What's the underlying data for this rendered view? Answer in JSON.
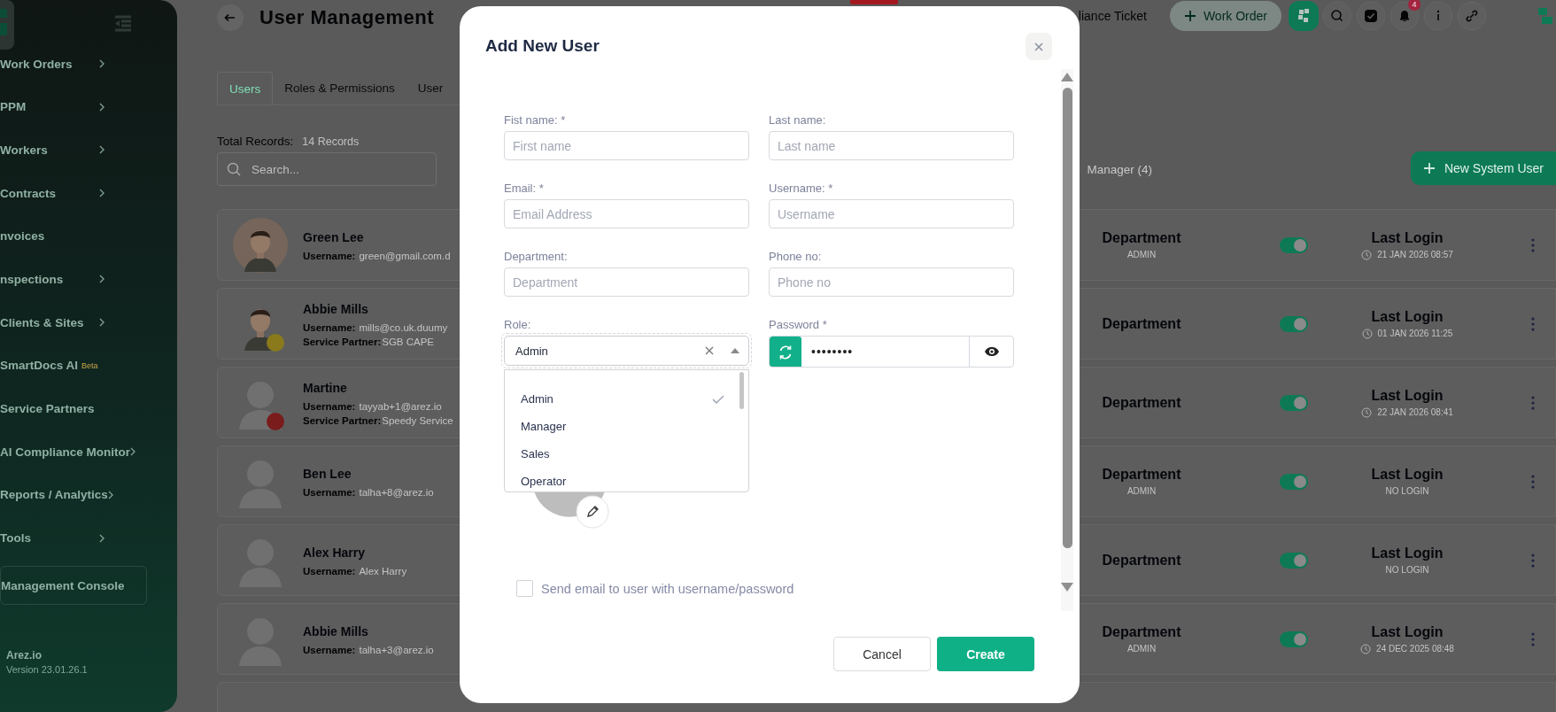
{
  "sidebar": {
    "items": [
      {
        "label": "Work Orders",
        "has_arrow": true,
        "selected": false
      },
      {
        "label": "PPM",
        "has_arrow": true,
        "selected": false
      },
      {
        "label": "Workers",
        "has_arrow": true,
        "selected": false
      },
      {
        "label": "Contracts",
        "has_arrow": true,
        "selected": false
      },
      {
        "label": "nvoices",
        "has_arrow": false,
        "selected": false
      },
      {
        "label": "nspections",
        "has_arrow": true,
        "selected": false
      },
      {
        "label": "Clients & Sites",
        "has_arrow": true,
        "selected": false
      },
      {
        "label": "SmartDocs AI",
        "tag": "Beta",
        "has_arrow": false,
        "selected": false
      },
      {
        "label": "Service Partners",
        "has_arrow": false,
        "selected": false
      },
      {
        "label": "AI Compliance Monitor",
        "has_arrow": true,
        "selected": false
      },
      {
        "label": "Reports / Analytics",
        "has_arrow": true,
        "selected": false
      },
      {
        "label": "Tools",
        "has_arrow": true,
        "selected": false
      },
      {
        "label": "Management Console",
        "has_arrow": false,
        "selected": true
      }
    ],
    "brand": "Arez.io",
    "version": "Version 23.01.26.1"
  },
  "header": {
    "title": "User Management",
    "ticket_label": "liance Ticket",
    "work_order_label": "Work Order",
    "notification_count": "4"
  },
  "tabs": [
    {
      "label": "Users",
      "selected": true
    },
    {
      "label": "Roles & Permissions",
      "selected": false
    },
    {
      "label": "User",
      "selected": false
    }
  ],
  "total_records": {
    "label": "Total Records:",
    "value": "14 Records"
  },
  "search": {
    "placeholder": "Search..."
  },
  "filter_label": "Manager (4)",
  "new_user_button": "New System User",
  "users": [
    {
      "name": "Green Lee",
      "kind": "illustrated",
      "username_label": "Username:",
      "username": "green@gmail.com.d",
      "department": "Department",
      "department_role": "ADMIN",
      "active": true,
      "last_login_label": "Last Login",
      "last_login": "21 JAN 2026 08:57"
    },
    {
      "name": "Abbie Mills",
      "kind": "illustrated",
      "color": "#8a7a1c",
      "username_label": "Username:",
      "username": "mills@co.uk.duumy",
      "partner_label": "Service Partner:",
      "partner": "SGB CAPE",
      "department": "Department",
      "active": true,
      "last_login_label": "Last Login",
      "last_login": "01 JAN 2026 11:25"
    },
    {
      "name": "Martine",
      "kind": "placeholder",
      "color": "#7a1c1c",
      "username_label": "Username:",
      "username": "tayyab+1@arez.io",
      "partner_label": "Service Partner:",
      "partner": "Speedy Service",
      "department": "Department",
      "active": true,
      "last_login_label": "Last Login",
      "last_login": "22 JAN 2026 08:41"
    },
    {
      "name": "Ben Lee",
      "kind": "placeholder",
      "username_label": "Username:",
      "username": "talha+8@arez.io",
      "department": "Department",
      "department_role": "ADMIN",
      "active": true,
      "last_login_label": "Last Login",
      "last_login": "NO LOGIN"
    },
    {
      "name": "Alex Harry",
      "kind": "placeholder",
      "username_label": "Username:",
      "username": "Alex Harry",
      "department": "Department",
      "active": true,
      "last_login_label": "Last Login",
      "last_login": "NO LOGIN"
    },
    {
      "name": "Abbie Mills",
      "kind": "placeholder",
      "username_label": "Username:",
      "username": "talha+3@arez.io",
      "department": "Department",
      "department_role": "ADMIN",
      "active": true,
      "last_login_label": "Last Login",
      "last_login": "24 DEC 2025 08:48"
    }
  ],
  "modal": {
    "title": "Add New User",
    "fields": [
      {
        "label": "Fist name: *",
        "placeholder": "First name"
      },
      {
        "label": "Last name:",
        "placeholder": "Last name"
      },
      {
        "label": "Email: *",
        "placeholder": "Email Address"
      },
      {
        "label": "Username: *",
        "placeholder": "Username"
      },
      {
        "label": "Department:",
        "placeholder": "Department"
      },
      {
        "label": "Phone no:",
        "placeholder": "Phone no"
      }
    ],
    "role": {
      "label": "Role:",
      "value": "Admin",
      "expanded": true,
      "options": [
        {
          "label": "Admin",
          "selected": true
        },
        {
          "label": "Manager",
          "selected": false
        },
        {
          "label": "Sales",
          "selected": false
        },
        {
          "label": "Operator",
          "selected": false
        }
      ]
    },
    "password": {
      "label": "Password *",
      "value": "••••••••"
    },
    "send_email": {
      "label": "Send email to user with username/password",
      "checked": false
    },
    "cancel_button": "Cancel",
    "create_button": "Create"
  }
}
